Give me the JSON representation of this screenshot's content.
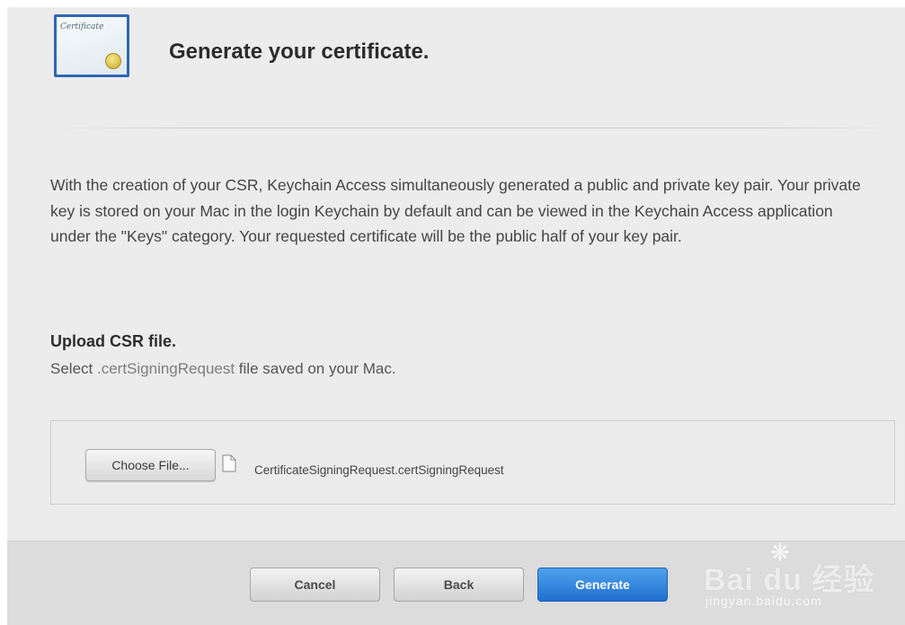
{
  "header": {
    "icon": "certificate-icon",
    "icon_text": "Certificate",
    "title": "Generate your certificate."
  },
  "description": "With the creation of your CSR, Keychain Access simultaneously generated a public and private key pair. Your private key is stored on your Mac in the login Keychain by default and can be viewed in the Keychain Access application under the \"Keys\" category. Your requested certificate will be the public half of your key pair.",
  "upload": {
    "heading": "Upload CSR file.",
    "sub_prefix": "Select ",
    "sub_ext": ".certSigningRequest",
    "sub_suffix": " file saved on your Mac.",
    "choose_button": "Choose File...",
    "file_icon": "document-icon",
    "file_name": "CertificateSigningRequest.certSigningRequest"
  },
  "footer": {
    "cancel_label": "Cancel",
    "back_label": "Back",
    "generate_label": "Generate"
  },
  "watermark": {
    "brand": "Bai du 经验",
    "url": "jingyan.baidu.com"
  },
  "colors": {
    "primary_button": "#2a7fd9",
    "icon_frame": "#2f66b3"
  }
}
